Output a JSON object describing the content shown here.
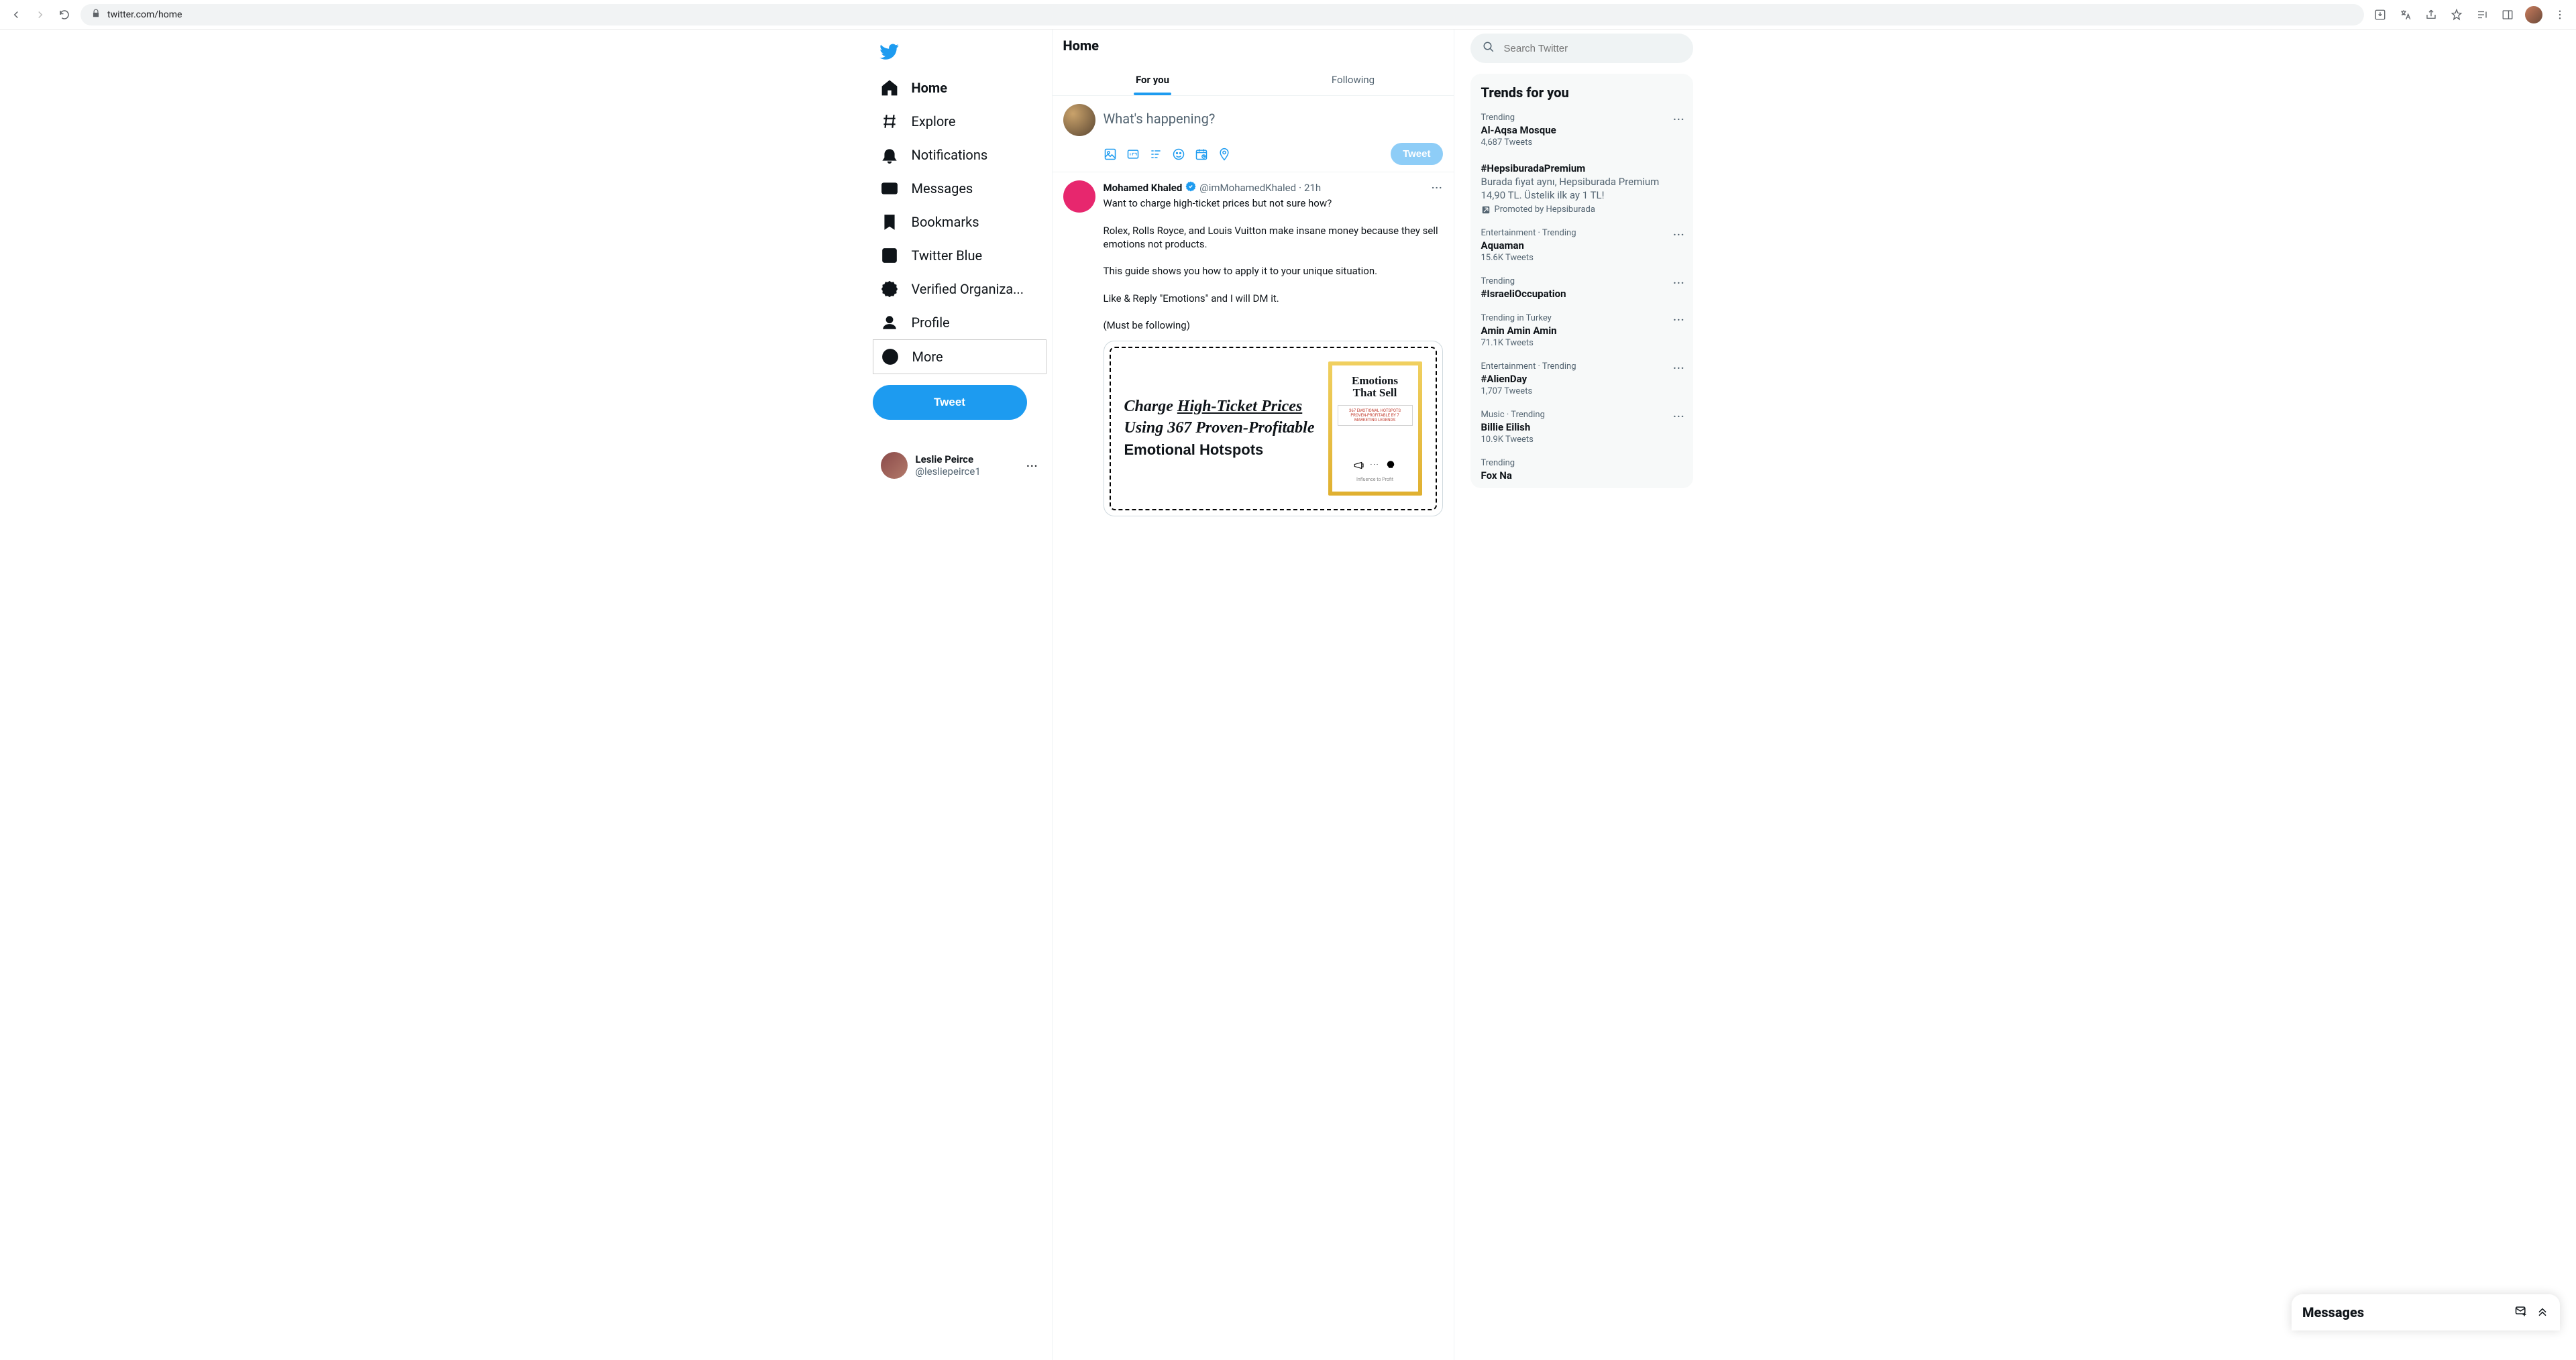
{
  "browser": {
    "url": "twitter.com/home"
  },
  "sidebar": {
    "items": [
      {
        "label": "Home"
      },
      {
        "label": "Explore"
      },
      {
        "label": "Notifications"
      },
      {
        "label": "Messages"
      },
      {
        "label": "Bookmarks"
      },
      {
        "label": "Twitter Blue"
      },
      {
        "label": "Verified Organiza..."
      },
      {
        "label": "Profile"
      },
      {
        "label": "More"
      }
    ],
    "tweet_label": "Tweet",
    "account": {
      "name": "Leslie Peirce",
      "handle": "@lesliepeirce1"
    }
  },
  "main": {
    "title": "Home",
    "tabs": [
      {
        "label": "For you",
        "selected": true
      },
      {
        "label": "Following",
        "selected": false
      }
    ],
    "compose": {
      "placeholder": "What's happening?",
      "submit": "Tweet"
    },
    "tweet": {
      "author": "Mohamed Khaled",
      "handle": "@imMohamedKhaled",
      "time": "21h",
      "text": "Want to charge high-ticket prices but not sure how?\n\nRolex, Rolls Royce, and Louis Vuitton make insane money because they sell emotions not products.\n\nThis guide shows you how to apply it to your unique situation.\n\nLike & Reply \"Emotions\" and I will DM it.\n\n(Must be following)",
      "image": {
        "headline_part1": "Charge ",
        "headline_underline": "High-Ticket Prices",
        "headline_part2": " Using 367 Proven-Profitable ",
        "headline_part3": "Emotional Hotspots",
        "book_title1": "Emotions",
        "book_title2": "That Sell",
        "book_sub": "367 EMOTIONAL HOTSPOTS PROVEN-PROFITABLE BY 7 MARKETING LEGENDS",
        "book_bottom": "Influence to Profit"
      }
    }
  },
  "search": {
    "placeholder": "Search Twitter"
  },
  "trends": {
    "title": "Trends for you",
    "items": [
      {
        "context": "Trending",
        "topic": "Al-Aqsa Mosque",
        "count": "4,687 Tweets"
      },
      {
        "context": "",
        "topic": "#HepsiburadaPremium",
        "desc": "Burada fiyat aynı, Hepsiburada Premium 14,90 TL. Üstelik ilk ay 1 TL!",
        "promo": "Promoted by Hepsiburada"
      },
      {
        "context": "Entertainment · Trending",
        "topic": "Aquaman",
        "count": "15.6K Tweets"
      },
      {
        "context": "Trending",
        "topic": "#IsraeliOccupation"
      },
      {
        "context": "Trending in Turkey",
        "topic": "Amin Amin Amin",
        "count": "71.1K Tweets"
      },
      {
        "context": "Entertainment · Trending",
        "topic": "#AlienDay",
        "count": "1,707 Tweets"
      },
      {
        "context": "Music · Trending",
        "topic": "Billie Eilish",
        "count": "10.9K Tweets"
      },
      {
        "context": "Trending",
        "topic": "Fox Na"
      }
    ]
  },
  "messages_dock": {
    "title": "Messages"
  }
}
